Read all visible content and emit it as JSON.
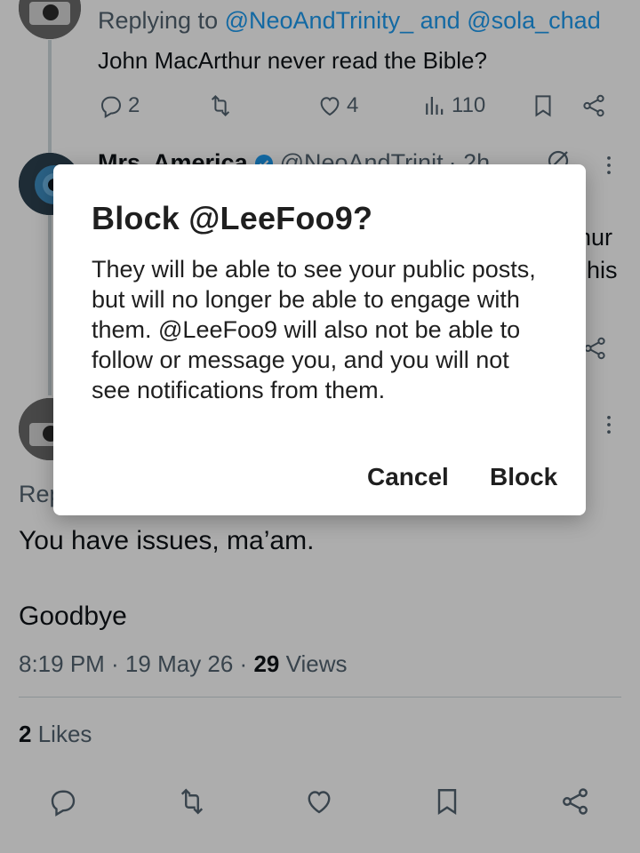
{
  "reply1": {
    "replying_prefix": "Replying to",
    "handle_a": "@NeoAndTrinity_",
    "conj": "and",
    "handle_b": "@sola_chad",
    "text": "John MacArthur never read the Bible?",
    "replies": "2",
    "likes": "4",
    "views": "110"
  },
  "reply2": {
    "name": "Mrs. America",
    "handle": "@NeoAndTrinit",
    "time": "· 2h",
    "text_frag_1": "nur",
    "text_frag_2": "his"
  },
  "main": {
    "replying_frag": "Rep",
    "line1": "You have issues, ma’am.",
    "line2": "Goodbye",
    "meta_time": "8:19 PM · 19 May 26 ·",
    "views_count": "29",
    "views_label": "Views",
    "likes_count": "2",
    "likes_label": "Likes"
  },
  "dialog": {
    "title": "Block @LeeFoo9?",
    "body": "They will be able to see your public posts, but will no longer be able to engage with them. @LeeFoo9 will also not be able to follow or message you, and you will not see notifications from them.",
    "cancel_label": "Cancel",
    "block_label": "Block"
  },
  "colors": {
    "link": "#1d9bf0",
    "muted": "#536471",
    "verified": "#1d9bf0"
  },
  "icons": [
    "reply-icon",
    "retweet-icon",
    "like-icon",
    "views-icon",
    "bookmark-icon",
    "share-icon",
    "more-icon",
    "verified-badge-icon",
    "grok-icon"
  ]
}
